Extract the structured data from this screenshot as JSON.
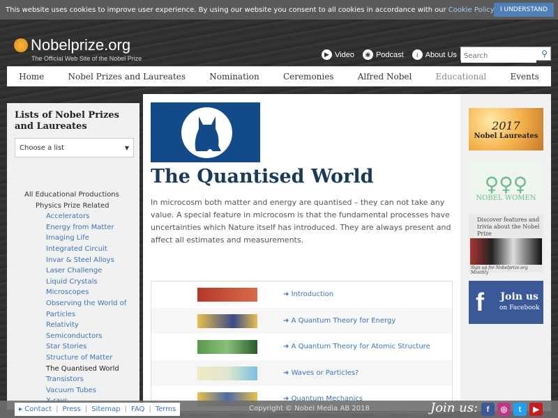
{
  "cookie": {
    "message": "This website uses cookies to improve user experience. By using our website you consent to all cookies in accordance with our",
    "policy_link": "Cookie Policy",
    "period": ".",
    "button": "I UNDERSTAND"
  },
  "header": {
    "logo": "Nobelprize.org",
    "tagline": "The Official Web Site of the Nobel Prize",
    "links": [
      {
        "label": "Video",
        "icon": "play-icon"
      },
      {
        "label": "Podcast",
        "icon": "podcast-icon"
      },
      {
        "label": "About Us",
        "icon": "info-icon"
      }
    ],
    "search_placeholder": "Search"
  },
  "nav": {
    "items": [
      "Home",
      "Nobel Prizes and Laureates",
      "Nomination",
      "Ceremonies",
      "Alfred Nobel",
      "Educational",
      "Events"
    ],
    "active": "Educational"
  },
  "sidebar": {
    "heading": "Lists of Nobel Prizes and Laureates",
    "select_value": "Choose a list",
    "items": [
      {
        "label": "All Educational Productions",
        "level": 1
      },
      {
        "label": "Physics Prize Related",
        "level": 2
      },
      {
        "label": "Accelerators",
        "level": 3
      },
      {
        "label": "Energy from Matter",
        "level": 3
      },
      {
        "label": "Imaging Life",
        "level": 3
      },
      {
        "label": "Integrated Circuit",
        "level": 3
      },
      {
        "label": "Invar & Steel Alloys",
        "level": 3
      },
      {
        "label": "Laser Challenge",
        "level": 3
      },
      {
        "label": "Liquid Crystals",
        "level": 3
      },
      {
        "label": "Microscopes",
        "level": 3
      },
      {
        "label": "Observing the World of",
        "level": 3
      },
      {
        "label": "Particles",
        "level": 3
      },
      {
        "label": "Relativity",
        "level": 3
      },
      {
        "label": "Semiconductors",
        "level": 3
      },
      {
        "label": "Star Stories",
        "level": 3
      },
      {
        "label": "Structure of Matter",
        "level": 3
      },
      {
        "label": "The Quantised World",
        "level": 3,
        "current": true
      },
      {
        "label": "Transistors",
        "level": 3
      },
      {
        "label": "Vacuum Tubes",
        "level": 3
      },
      {
        "label": "X-rays",
        "level": 3
      }
    ]
  },
  "main": {
    "title": "The Quantised World",
    "intro": "In microcosm both matter and energy are quantised – they can not take any value. A special feature in microcosm is that the fundamental processes have uncertainties which Nature itself has introduced. They are always present and affect all estimates and measurements.",
    "sections": [
      {
        "label": "Introduction",
        "colors": [
          "#b43a2a",
          "#d96a4a"
        ]
      },
      {
        "label": "A Quantum Theory for Energy",
        "colors": [
          "#e8c04a",
          "#3a4a8a"
        ]
      },
      {
        "label": "A Quantum Theory for Atomic Structure",
        "colors": [
          "#5a9a4a",
          "#2a5a2a"
        ]
      },
      {
        "label": "Waves or Particles?",
        "colors": [
          "#f2e9c0",
          "#7ac0e0"
        ]
      },
      {
        "label": "Quantum Mechanics",
        "colors": [
          "#e8c04a",
          "#4a6aaa"
        ]
      }
    ]
  },
  "right": {
    "laureates_year": "2017",
    "laureates_label": "Nobel Laureates",
    "women_label": "NOBEL WOMEN",
    "discover": "Discover features and trivia about the Nobel Prize",
    "signup": "Sign up for Nobelprize.org Monthly",
    "facebook_join": "Join us",
    "facebook_on": "on Facebook"
  },
  "footer": {
    "links": [
      "Contact",
      "Press",
      "Sitemap",
      "FAQ",
      "Terms"
    ],
    "copyright": "Copyright © Nobel Media AB 2018",
    "join": "Join us:",
    "social": [
      {
        "label": "f",
        "color": "#3b5998",
        "icon": "facebook-icon"
      },
      {
        "label": "◎",
        "color": "#c13584",
        "icon": "instagram-icon"
      },
      {
        "label": "t",
        "color": "#1da1f2",
        "icon": "twitter-icon"
      },
      {
        "label": "▶",
        "color": "#cc181e",
        "icon": "youtube-icon"
      }
    ]
  }
}
